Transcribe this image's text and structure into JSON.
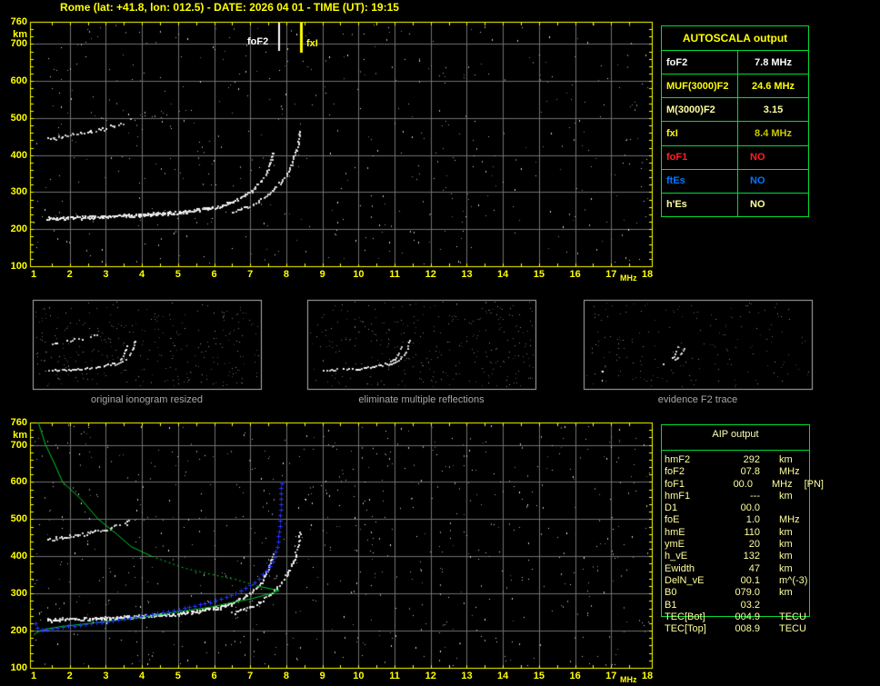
{
  "header": {
    "title": "Rome (lat: +41.8, lon: 012.5) - DATE: 2026 04 01 - TIME (UT): 19:15"
  },
  "markers": {
    "fof2_label": "foF2",
    "fxi_label": "fxI"
  },
  "axes": {
    "y_ticks": [
      {
        "label": "760",
        "km": 760
      },
      {
        "label": "km",
        "km": 726
      },
      {
        "label": "700",
        "km": 700
      },
      {
        "label": "600",
        "km": 600
      },
      {
        "label": "500",
        "km": 500
      },
      {
        "label": "400",
        "km": 400
      },
      {
        "label": "300",
        "km": 300
      },
      {
        "label": "200",
        "km": 200
      },
      {
        "label": "100",
        "km": 100
      }
    ],
    "x_ticks": [
      {
        "label": "1",
        "f": 1
      },
      {
        "label": "2",
        "f": 2
      },
      {
        "label": "3",
        "f": 3
      },
      {
        "label": "4",
        "f": 4
      },
      {
        "label": "5",
        "f": 5
      },
      {
        "label": "6",
        "f": 6
      },
      {
        "label": "7",
        "f": 7
      },
      {
        "label": "8",
        "f": 8
      },
      {
        "label": "9",
        "f": 9
      },
      {
        "label": "10",
        "f": 10
      },
      {
        "label": "11",
        "f": 11
      },
      {
        "label": "12",
        "f": 12
      },
      {
        "label": "13",
        "f": 13
      },
      {
        "label": "14",
        "f": 14
      },
      {
        "label": "15",
        "f": 15
      },
      {
        "label": "16",
        "f": 16
      },
      {
        "label": "17",
        "f": 17
      },
      {
        "label": "18",
        "f": 18
      }
    ],
    "x_unit": "MHz"
  },
  "autoscala": {
    "title": "AUTOSCALA output",
    "rows": [
      {
        "param": "foF2",
        "value": "7.8 MHz",
        "label_color": "#ffffff",
        "value_color": "#ffffff"
      },
      {
        "param": "MUF(3000)F2",
        "value": "24.6 MHz",
        "label_color": "#ffff00",
        "value_color": "#ffff00"
      },
      {
        "param": "M(3000)F2",
        "value": "3.15",
        "label_color": "#ffff9e",
        "value_color": "#ffff9e"
      },
      {
        "param": "fxI",
        "value": "8.4 MHz",
        "label_color": "#ffff00",
        "value_color": "#c8c800"
      },
      {
        "param": "foF1",
        "value": "NO",
        "label_color": "#ff2020",
        "value_color": "#ff2020"
      },
      {
        "param": "ftEs",
        "value": "NO",
        "label_color": "#0077ff",
        "value_color": "#0077ff"
      },
      {
        "param": "h'Es",
        "value": "NO",
        "label_color": "#ffff9e",
        "value_color": "#ffff9e"
      }
    ]
  },
  "thumbnails": {
    "captions": [
      "original ionogram resized",
      "eliminate multiple reflections",
      "evidence F2 trace"
    ]
  },
  "aip": {
    "title": "AIP output",
    "rows": [
      {
        "param": "hmF2",
        "value": "292",
        "unit": "km",
        "note": ""
      },
      {
        "param": "foF2",
        "value": "07.8",
        "unit": "MHz",
        "note": ""
      },
      {
        "param": "foF1",
        "value": "00.0",
        "unit": "MHz",
        "note": "[PN]"
      },
      {
        "param": "hmF1",
        "value": "---",
        "unit": "km",
        "note": ""
      },
      {
        "param": "D1",
        "value": "00.0",
        "unit": "",
        "note": ""
      },
      {
        "param": "foE",
        "value": "1.0",
        "unit": "MHz",
        "note": ""
      },
      {
        "param": "hmE",
        "value": "110",
        "unit": "km",
        "note": ""
      },
      {
        "param": "ymE",
        "value": "20",
        "unit": "km",
        "note": ""
      },
      {
        "param": "h_vE",
        "value": "132",
        "unit": "km",
        "note": ""
      },
      {
        "param": "Ewidth",
        "value": "47",
        "unit": "km",
        "note": ""
      },
      {
        "param": "DelN_vE",
        "value": "00.1",
        "unit": "m^(-3)",
        "note": ""
      },
      {
        "param": "B0",
        "value": "079.0",
        "unit": "km",
        "note": ""
      },
      {
        "param": "B1",
        "value": "03.2",
        "unit": "",
        "note": ""
      },
      {
        "param": "TEC[Bot]",
        "value": "004.9",
        "unit": "TECU",
        "note": ""
      },
      {
        "param": "TEC[Top]",
        "value": "008.9",
        "unit": "TECU",
        "note": ""
      }
    ]
  },
  "plot_data": {
    "freq_axis": {
      "min": 1,
      "max": 18,
      "unit": "MHz"
    },
    "height_axis": {
      "min": 100,
      "max": 760,
      "unit": "km"
    },
    "scaled": {
      "fof2_mhz": 7.8,
      "fxi_mhz": 8.4
    },
    "traces": {
      "f_trace_o": [
        [
          1.35,
          230
        ],
        [
          2,
          232
        ],
        [
          3,
          235
        ],
        [
          4,
          240
        ],
        [
          5,
          247
        ],
        [
          5.6,
          254
        ],
        [
          6.1,
          263
        ],
        [
          6.5,
          275
        ],
        [
          6.8,
          290
        ],
        [
          7.05,
          307
        ],
        [
          7.25,
          327
        ],
        [
          7.4,
          348
        ],
        [
          7.5,
          370
        ],
        [
          7.58,
          392
        ],
        [
          7.63,
          410
        ]
      ],
      "f_trace_x": [
        [
          6.5,
          248
        ],
        [
          6.9,
          260
        ],
        [
          7.2,
          275
        ],
        [
          7.45,
          292
        ],
        [
          7.65,
          310
        ],
        [
          7.85,
          330
        ],
        [
          8.0,
          352
        ],
        [
          8.12,
          375
        ],
        [
          8.22,
          400
        ],
        [
          8.3,
          428
        ],
        [
          8.35,
          455
        ],
        [
          8.37,
          472
        ]
      ],
      "second_reflection": [
        [
          1.4,
          446
        ],
        [
          1.7,
          450
        ],
        [
          2.0,
          455
        ],
        [
          2.3,
          460
        ],
        [
          2.6,
          466
        ],
        [
          2.9,
          473
        ],
        [
          3.2,
          481
        ],
        [
          3.5,
          490
        ],
        [
          3.7,
          498
        ]
      ],
      "second_reflection_sparse": [
        [
          3.8,
          500
        ],
        [
          4.2,
          506
        ],
        [
          4.6,
          512
        ],
        [
          5.0,
          518
        ],
        [
          5.4,
          526
        ]
      ]
    },
    "profile_green": {
      "topside": [
        [
          1.13,
          760
        ],
        [
          1.33,
          700
        ],
        [
          1.6,
          645
        ],
        [
          1.8,
          600
        ],
        [
          2.3,
          555
        ],
        [
          2.79,
          500
        ],
        [
          3.3,
          460
        ],
        [
          3.7,
          426
        ],
        [
          4.27,
          400
        ],
        [
          5.18,
          368
        ],
        [
          5.94,
          351
        ],
        [
          6.62,
          337
        ],
        [
          7.2,
          320
        ],
        [
          7.6,
          312
        ],
        [
          7.8,
          308
        ]
      ],
      "bottomside": [
        [
          7.8,
          308
        ],
        [
          7.5,
          298
        ],
        [
          7.0,
          285
        ],
        [
          6.5,
          276
        ],
        [
          5.94,
          264
        ],
        [
          5.1,
          252
        ],
        [
          4.27,
          239
        ],
        [
          3.42,
          229
        ],
        [
          2.6,
          220
        ],
        [
          1.76,
          211
        ],
        [
          1.33,
          204
        ],
        [
          1.1,
          196
        ],
        [
          1.0,
          188
        ]
      ]
    },
    "restored_trace_blue": [
      [
        1.0,
        233
      ],
      [
        1.05,
        218
      ],
      [
        1.1,
        205
      ],
      [
        1.3,
        203
      ],
      [
        1.6,
        207
      ],
      [
        2.0,
        212
      ],
      [
        2.4,
        217
      ],
      [
        2.8,
        222
      ],
      [
        3.2,
        227
      ],
      [
        3.6,
        233
      ],
      [
        4.0,
        239
      ],
      [
        4.4,
        246
      ],
      [
        4.8,
        253
      ],
      [
        5.2,
        261
      ],
      [
        5.6,
        270
      ],
      [
        6.0,
        280
      ],
      [
        6.3,
        290
      ],
      [
        6.6,
        301
      ],
      [
        6.85,
        313
      ],
      [
        7.05,
        325
      ],
      [
        7.25,
        340
      ],
      [
        7.4,
        355
      ],
      [
        7.55,
        373
      ],
      [
        7.65,
        393
      ],
      [
        7.72,
        415
      ],
      [
        7.77,
        440
      ],
      [
        7.8,
        465
      ],
      [
        7.82,
        490
      ],
      [
        7.84,
        520
      ],
      [
        7.85,
        550
      ],
      [
        7.86,
        578
      ],
      [
        7.87,
        600
      ]
    ],
    "thumb_traces": {
      "f_o": [
        [
          2.1,
          233
        ],
        [
          3,
          236
        ],
        [
          4,
          241
        ],
        [
          5,
          248
        ],
        [
          5.8,
          257
        ],
        [
          6.4,
          268
        ],
        [
          6.9,
          284
        ],
        [
          7.3,
          305
        ],
        [
          7.6,
          330
        ],
        [
          7.8,
          360
        ],
        [
          7.95,
          395
        ],
        [
          8.05,
          430
        ]
      ],
      "f_x": [
        [
          7.0,
          270
        ],
        [
          7.4,
          288
        ],
        [
          7.8,
          312
        ],
        [
          8.1,
          340
        ],
        [
          8.35,
          375
        ],
        [
          8.5,
          415
        ],
        [
          8.6,
          455
        ],
        [
          8.65,
          477
        ]
      ],
      "second": [
        [
          2.4,
          437
        ],
        [
          3.0,
          448
        ],
        [
          3.6,
          458
        ],
        [
          4.2,
          468
        ],
        [
          4.8,
          480
        ],
        [
          5.4,
          492
        ],
        [
          6.0,
          508
        ]
      ]
    }
  }
}
